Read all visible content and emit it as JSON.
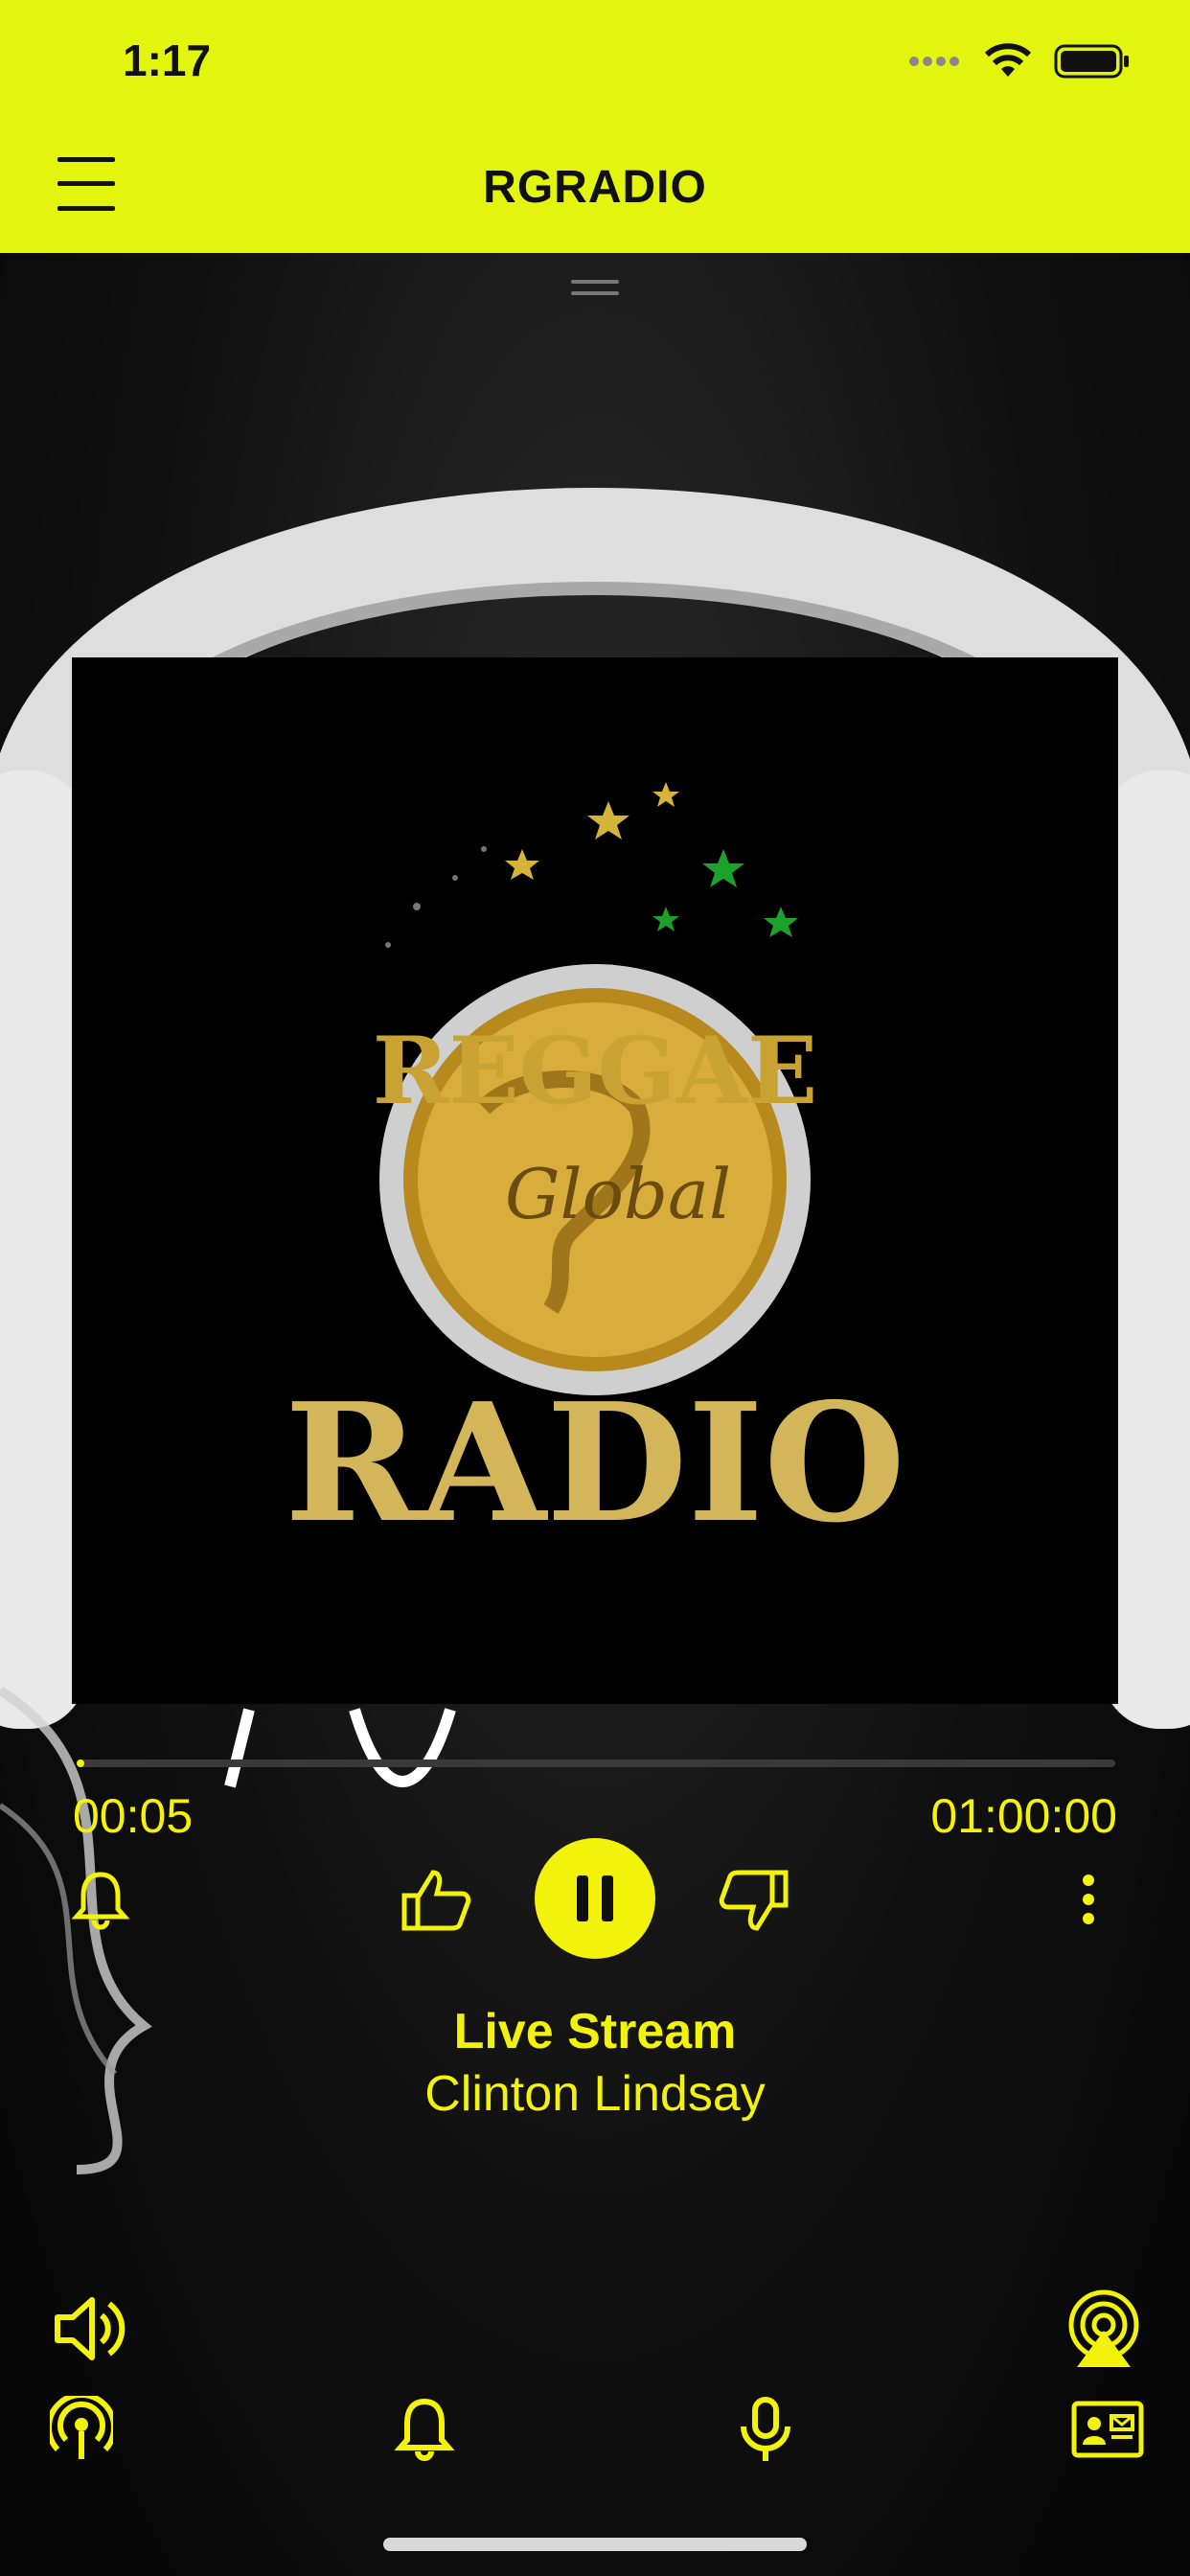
{
  "status_bar": {
    "time": "1:17"
  },
  "header": {
    "title": "RGRADIO"
  },
  "player": {
    "elapsed": "00:05",
    "duration": "01:00:00",
    "progress_fraction": 0.0014,
    "track_title": "Live Stream",
    "track_artist": "Clinton Lindsay",
    "is_playing": true
  },
  "artwork": {
    "logo_word_top": "REGGAE",
    "logo_word_script": "Global",
    "logo_word_bottom": "RADIO"
  },
  "colors": {
    "accent": "#f2f20a",
    "header_bg": "#e3f50f",
    "background": "#000000"
  },
  "icons": {
    "menu": "hamburger-icon",
    "alarm": "bell-icon",
    "like": "thumbs-up-icon",
    "play_pause": "pause-icon",
    "dislike": "thumbs-down-icon",
    "more": "more-vertical-icon",
    "volume": "speaker-icon",
    "airplay": "airplay-icon",
    "broadcast": "broadcast-icon",
    "notify": "bell-icon",
    "mic": "microphone-icon",
    "contact": "contact-card-icon"
  }
}
